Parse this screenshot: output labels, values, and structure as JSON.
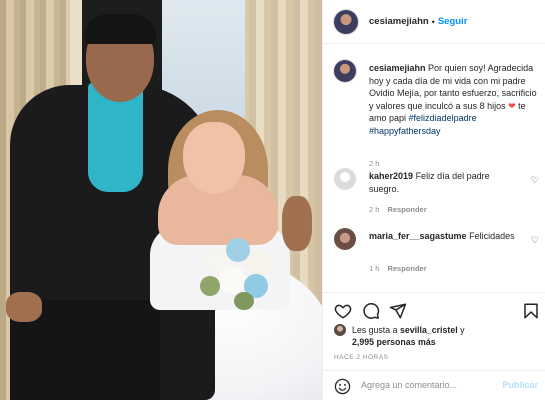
{
  "photo": {
    "alt": ""
  },
  "header": {
    "username": "cesiamejiahn",
    "separator": "•",
    "follow_label": "Seguir"
  },
  "caption": {
    "username": "cesiamejiahn",
    "text_before_heart": "Por quien soy! Agradecida hoy y cada día de mi vida con mi padre Ovidio Mejía, por tanto esfuerzo, sacrificio y valores que inculcó a sus 8 hijos",
    "heart": "❤",
    "text_after_heart": "te amo papi",
    "hashtag1": "#felizdiadelpadre",
    "hashtag2": "#happyfathersday",
    "time": "2 h"
  },
  "comments": [
    {
      "username": "kaher2019",
      "text": "Feliz día del padre suegro.",
      "time": "2 h",
      "reply_label": "Responder"
    },
    {
      "username": "maria_fer__sagastume",
      "text": "Felicidades",
      "time": "1 h",
      "reply_label": "Responder"
    }
  ],
  "likes": {
    "prefix": "Les gusta a",
    "user": "sevilla_cristel",
    "connector": "y",
    "count_text": "2,995 personas más"
  },
  "timestamp": "HACE 2 HORAS",
  "composer": {
    "placeholder": "Agrega un comentario...",
    "post_label": "Publicar"
  },
  "icons": {
    "like": "heart-icon",
    "comment": "comment-icon",
    "share": "paper-plane-icon",
    "save": "bookmark-icon",
    "emoji": "smiley-icon"
  },
  "colors": {
    "link_blue": "#0095f6",
    "hashtag": "#00376b",
    "heart_red": "#ed4956",
    "muted": "#8e8e8e"
  }
}
